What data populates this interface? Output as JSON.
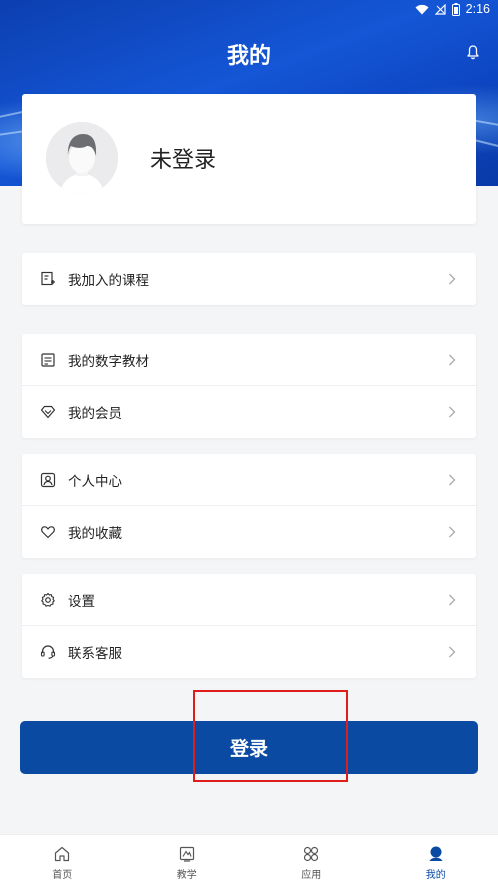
{
  "status_bar": {
    "time": "2:16"
  },
  "header": {
    "title": "我的"
  },
  "profile": {
    "login_state": "未登录"
  },
  "groups": [
    {
      "items": [
        {
          "label": "我加入的课程",
          "icon": "course-icon"
        }
      ]
    },
    {
      "items": [
        {
          "label": "我的数字教材",
          "icon": "textbook-icon"
        },
        {
          "label": "我的会员",
          "icon": "diamond-icon"
        }
      ]
    },
    {
      "items": [
        {
          "label": "个人中心",
          "icon": "person-icon"
        },
        {
          "label": "我的收藏",
          "icon": "heart-icon"
        }
      ]
    },
    {
      "items": [
        {
          "label": "设置",
          "icon": "gear-icon"
        },
        {
          "label": "联系客服",
          "icon": "headset-icon"
        }
      ]
    }
  ],
  "login_button": {
    "label": "登录"
  },
  "tabbar": {
    "tabs": [
      {
        "label": "首页",
        "icon": "home-icon"
      },
      {
        "label": "教学",
        "icon": "teaching-icon"
      },
      {
        "label": "应用",
        "icon": "apps-icon"
      },
      {
        "label": "我的",
        "icon": "profile-icon",
        "active": true
      }
    ]
  },
  "colors": {
    "brand": "#0a4aa3",
    "highlight": "#e01c1c",
    "background": "#f4f5f7"
  }
}
